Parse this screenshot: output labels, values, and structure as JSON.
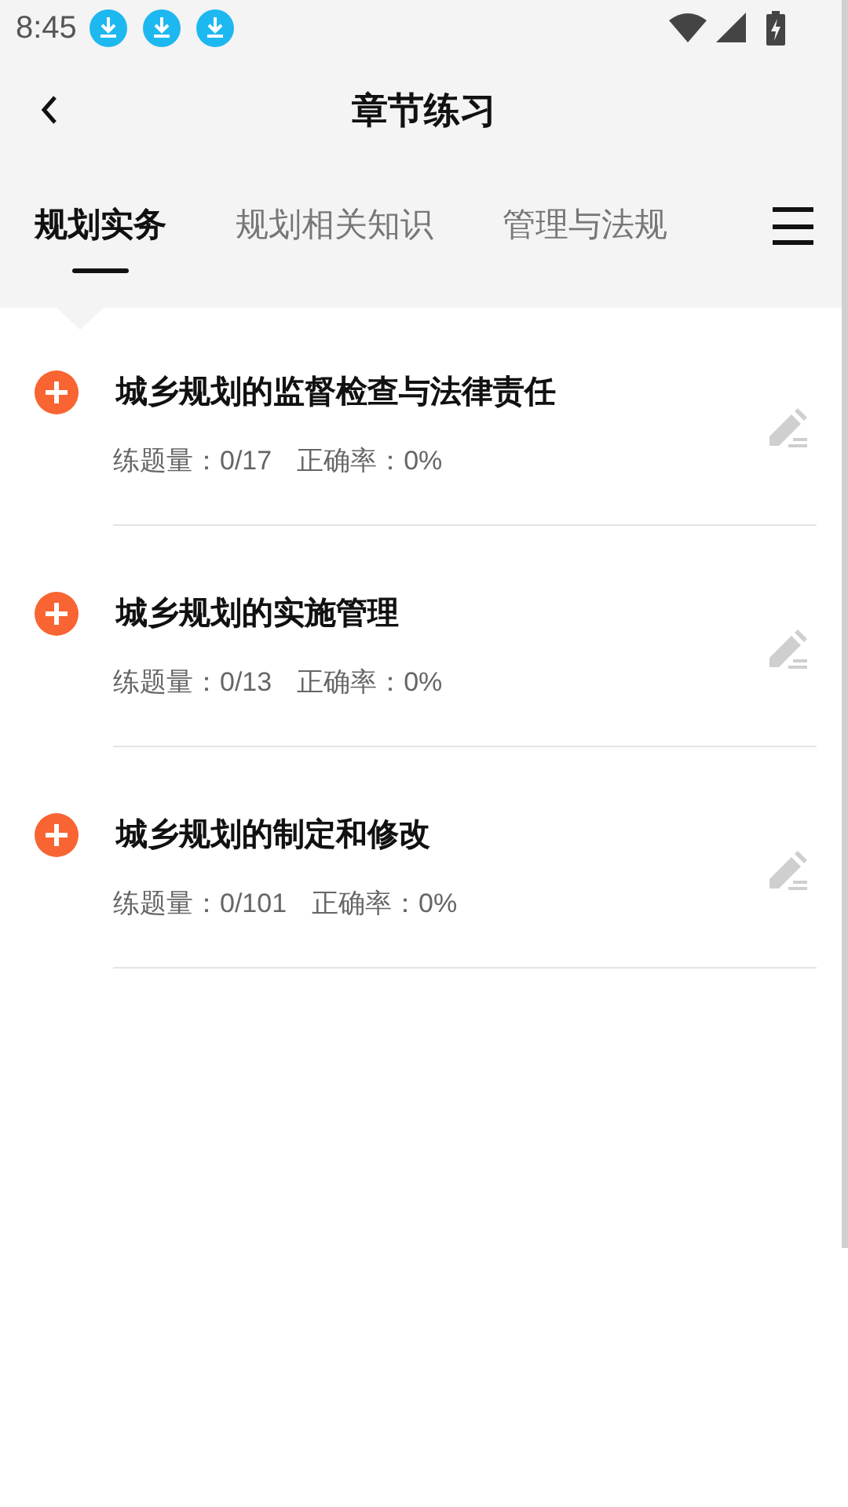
{
  "status_bar": {
    "time": "8:45",
    "notifications": [
      {
        "kind": "download"
      },
      {
        "kind": "download"
      },
      {
        "kind": "download"
      }
    ]
  },
  "header": {
    "title": "章节练习"
  },
  "tabs": [
    {
      "label": "规划实务",
      "selected": true
    },
    {
      "label": "规划相关知识",
      "selected": false
    },
    {
      "label": "管理与法规",
      "selected": false
    }
  ],
  "chapters": [
    {
      "title": "城乡规划的监督检查与法律责任",
      "count": "练题量：0/17",
      "accuracy": "正确率：0%"
    },
    {
      "title": "城乡规划的实施管理",
      "count": "练题量：0/13",
      "accuracy": "正确率：0%"
    },
    {
      "title": "城乡规划的制定和修改",
      "count": "练题量：0/101",
      "accuracy": "正确率：0%"
    }
  ]
}
